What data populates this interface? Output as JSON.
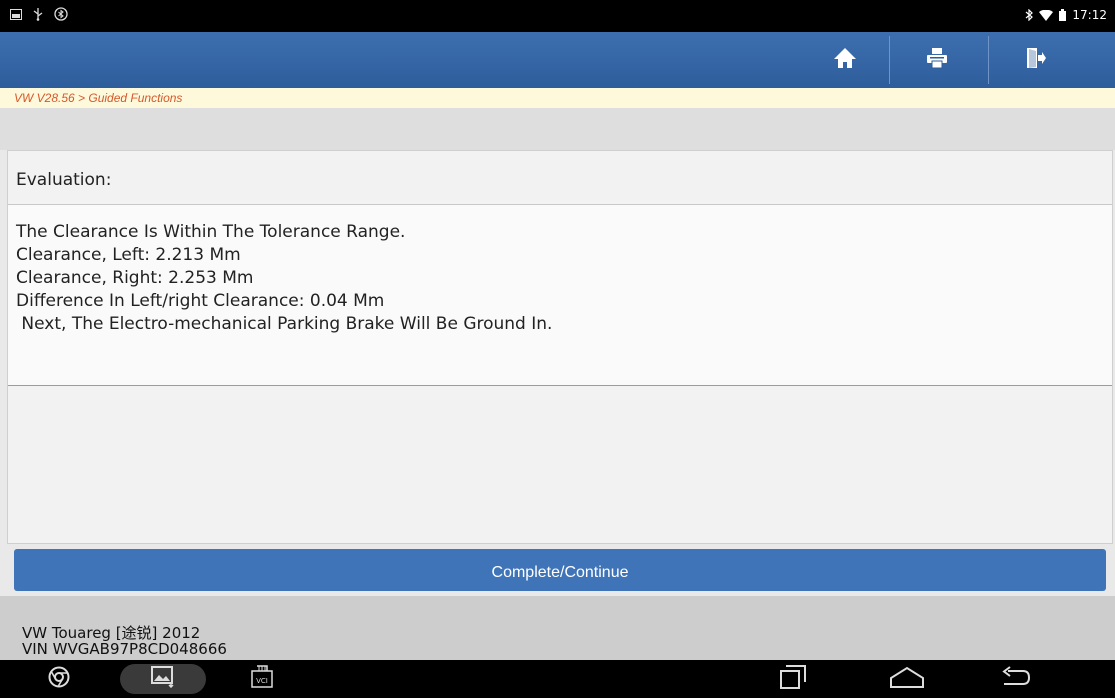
{
  "status_bar": {
    "time": "17:12",
    "left_icons": [
      "notification-icon",
      "usb-icon",
      "bluetooth-icon"
    ],
    "right_icons": [
      "bluetooth-icon",
      "wifi-icon",
      "battery-icon"
    ]
  },
  "toolbar": {
    "color": "#3566a5",
    "buttons": [
      "home-icon",
      "print-icon",
      "exit-icon"
    ]
  },
  "breadcrumb": "VW V28.56 > Guided Functions",
  "evaluation": {
    "header": "Evaluation:",
    "lines": [
      "The Clearance Is Within The Tolerance Range.",
      "Clearance, Left: 2.213 Mm",
      "Clearance, Right: 2.253 Mm",
      "Difference In Left/right Clearance: 0.04 Mm",
      " Next, The Electro-mechanical Parking Brake Will Be Ground In."
    ]
  },
  "continue_button": "Complete/Continue",
  "vehicle": {
    "model": "VW Touareg [途锐] 2012",
    "vin": "VIN WVGAB97P8CD048666"
  },
  "nav_bar": {
    "vci_label": "VCI",
    "items": [
      "chrome-icon",
      "gallery-icon",
      "vci-icon",
      "recent-apps-icon",
      "home-nav-icon",
      "back-icon"
    ]
  }
}
